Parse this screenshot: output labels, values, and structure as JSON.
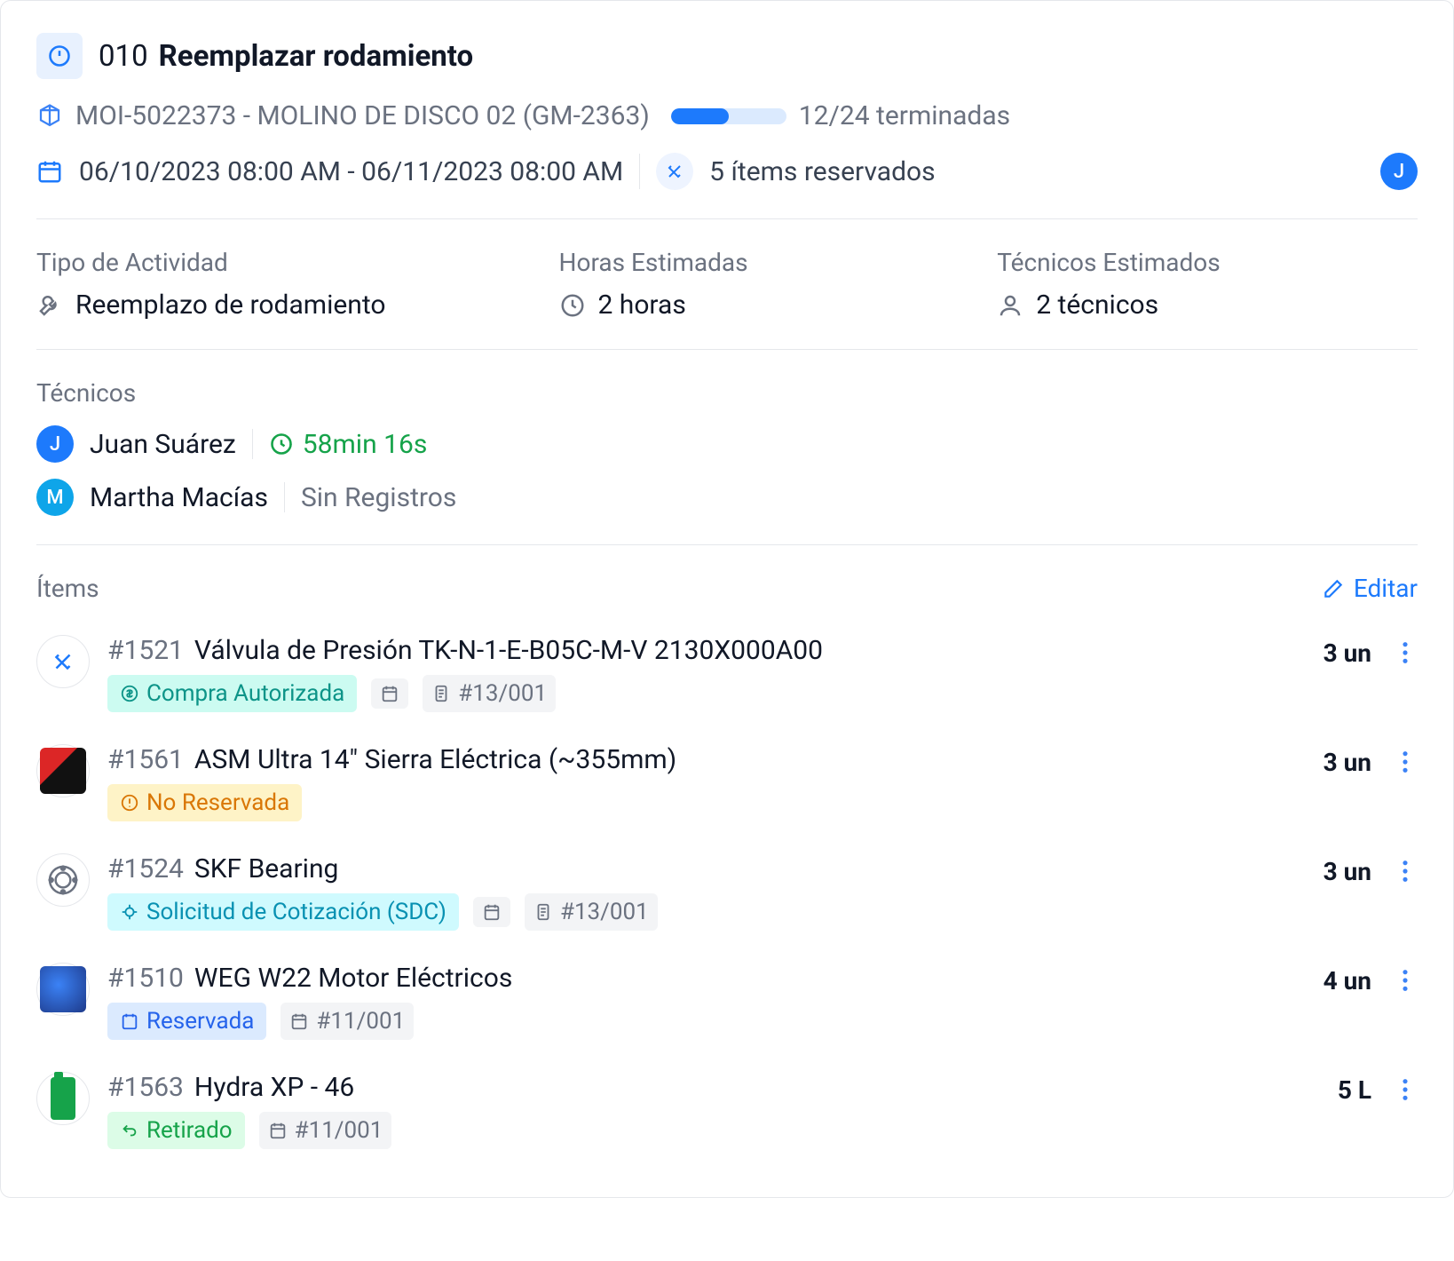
{
  "header": {
    "code": "010",
    "name": "Reemplazar rodamiento",
    "asset_code": "MOI-5022373 - MOLINO DE DISCO 02 (GM-2363)",
    "progress_text": "12/24 terminadas",
    "progress_pct": 50,
    "date_range": "06/10/2023 08:00 AM - 06/11/2023 08:00 AM",
    "reserved_items": "5 ítems reservados",
    "assignee_initial": "J"
  },
  "summary": {
    "activity_label": "Tipo de Actividad",
    "activity_value": "Reemplazo de rodamiento",
    "hours_label": "Horas Estimadas",
    "hours_value": "2 horas",
    "techs_label": "Técnicos Estimados",
    "techs_value": "2 técnicos"
  },
  "techs": {
    "label": "Técnicos",
    "rows": [
      {
        "initial": "J",
        "name": "Juan Suárez",
        "timer": "58min 16s",
        "no_records": ""
      },
      {
        "initial": "M",
        "name": "Martha Macías",
        "timer": "",
        "no_records": "Sin Registros"
      }
    ]
  },
  "items": {
    "label": "Ítems",
    "edit_label": "Editar",
    "rows": [
      {
        "id": "#1521",
        "name": "Válvula de Presión TK-N-1-E-B05C-M-V 2130X000A00",
        "qty": "3 un",
        "thumb": "tools",
        "badge": {
          "text": "Compra Autorizada",
          "class": "badge-teal",
          "icon": "dollar"
        },
        "chips": [
          {
            "icon": "calendar",
            "text": ""
          },
          {
            "icon": "doc",
            "text": "#13/001"
          }
        ]
      },
      {
        "id": "#1561",
        "name": "ASM Ultra 14\" Sierra Eléctrica (~355mm)",
        "qty": "3 un",
        "thumb": "saw",
        "badge": {
          "text": "No Reservada",
          "class": "badge-amber",
          "icon": "alert"
        },
        "chips": []
      },
      {
        "id": "#1524",
        "name": "SKF Bearing",
        "qty": "3 un",
        "thumb": "bearing",
        "badge": {
          "text": "Solicitud de Cotización (SDC)",
          "class": "badge-cyan",
          "icon": "quote"
        },
        "chips": [
          {
            "icon": "calendar",
            "text": ""
          },
          {
            "icon": "doc",
            "text": "#13/001"
          }
        ]
      },
      {
        "id": "#1510",
        "name": "WEG W22 Motor Eléctricos",
        "qty": "4 un",
        "thumb": "motor",
        "badge": {
          "text": "Reservada",
          "class": "badge-blue",
          "icon": "bookmark"
        },
        "chips": [
          {
            "icon": "calendar",
            "text": "#11/001"
          }
        ]
      },
      {
        "id": "#1563",
        "name": "Hydra XP - 46",
        "qty": "5 L",
        "thumb": "oil",
        "badge": {
          "text": "Retirado",
          "class": "badge-green",
          "icon": "return"
        },
        "chips": [
          {
            "icon": "calendar",
            "text": "#11/001"
          }
        ]
      }
    ]
  }
}
